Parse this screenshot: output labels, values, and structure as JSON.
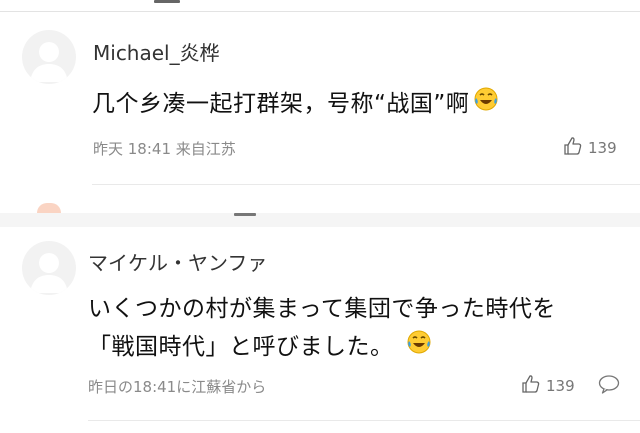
{
  "comment_cn": {
    "username": "Michael_炎桦",
    "text": "几个乡凑一起打群架，号称“战国”啊",
    "emoji": "laughing-tears-emoji",
    "meta": "昨天 18:41 来自江苏",
    "like_count": "139",
    "like_icon": "thumbs-up-icon"
  },
  "comment_jp": {
    "username": "マイケル・ヤンファ",
    "text_line1": "いくつかの村が集まって集団で争った時代を",
    "text_line2": "「戦国時代」と呼びました。",
    "emoji": "laughing-tears-emoji",
    "meta": "昨日の18:41に江蘇省から",
    "like_count": "139",
    "like_icon": "thumbs-up-icon",
    "reply_icon": "speech-bubble-icon"
  },
  "colors": {
    "avatar_bg": "#f2f2f2",
    "avatar_fg": "#ffffff",
    "meta_text": "#8a8a8a",
    "emoji_yellow": "#ffcc33",
    "emoji_tear": "#3aa0e6"
  }
}
